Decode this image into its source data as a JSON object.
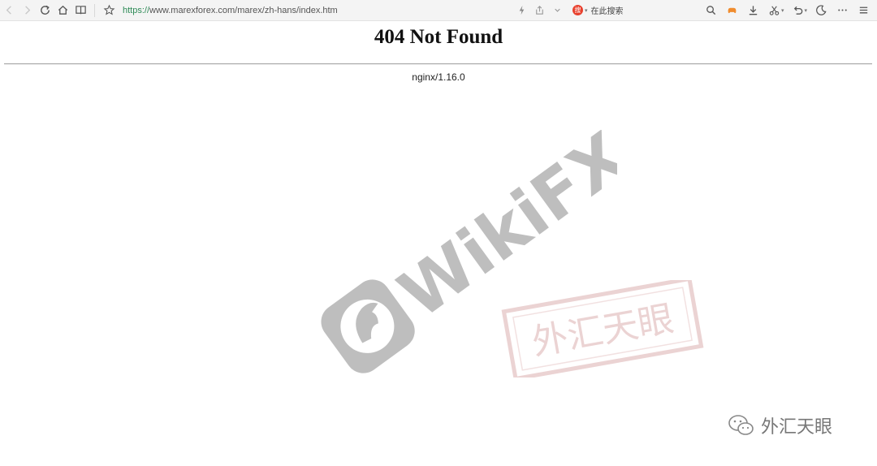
{
  "browser": {
    "url_protocol": "https://",
    "url_rest": "www.marexforex.com/marex/zh-hans/index.htm",
    "search_placeholder": "在此搜索",
    "search_engine_glyph": "搜"
  },
  "page": {
    "title": "404 Not Found",
    "server": "nginx/1.16.0"
  },
  "watermark": {
    "brand": "WikiFX",
    "stamp": "外汇天眼",
    "account": "外汇天眼"
  },
  "colors": {
    "toolbar_bg": "#f4f4f4",
    "url_protocol": "#2e8b57",
    "watermark_gray": "#8a8a8a",
    "stamp_red": "#d9a8a8"
  }
}
